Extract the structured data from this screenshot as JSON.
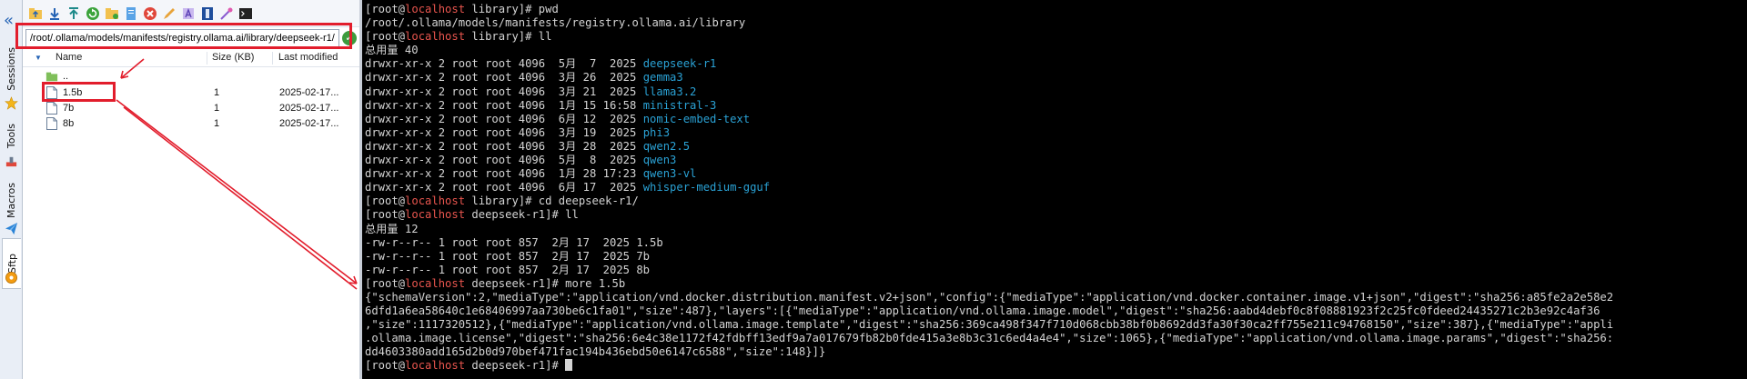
{
  "sidebar": {
    "tabs": [
      {
        "label": "Sessions",
        "icon": "star-icon"
      },
      {
        "label": "Tools",
        "icon": "tools-icon"
      },
      {
        "label": "Macros",
        "icon": "paper-plane-icon"
      },
      {
        "label": "Sftp",
        "icon": "sftp-icon"
      }
    ]
  },
  "toolbar": {
    "icons": [
      "folder-up-icon",
      "download-icon",
      "upload-icon",
      "refresh-icon",
      "new-folder-icon",
      "new-file-icon",
      "delete-icon",
      "edit-icon",
      "text-icon",
      "column-icon",
      "magic-icon",
      "terminal-icon"
    ]
  },
  "sftp": {
    "path": "/root/.ollama/models/manifests/registry.ollama.ai/library/deepseek-r1/",
    "columns": {
      "name": "Name",
      "size": "Size (KB)",
      "modified": "Last modified"
    },
    "files": [
      {
        "name": "..",
        "size": "",
        "modified": "",
        "type": "parent"
      },
      {
        "name": "1.5b",
        "size": "1",
        "modified": "2025-02-17...",
        "type": "file"
      },
      {
        "name": "7b",
        "size": "1",
        "modified": "2025-02-17...",
        "type": "file"
      },
      {
        "name": "8b",
        "size": "1",
        "modified": "2025-02-17...",
        "type": "file"
      }
    ]
  },
  "colors": {
    "accent": "#2563b5",
    "annotation": "#e21d2c",
    "terminal_bg": "#000000",
    "terminal_fg": "#d4d4d4",
    "prompt_host": "#e8554e",
    "dir_color": "#2aa1d4"
  },
  "terminal": {
    "prompt_open": "[root@",
    "host": "localhost",
    "lines": [
      {
        "kind": "prompt",
        "cwd": " library]# ",
        "cmd": "pwd"
      },
      {
        "kind": "out",
        "text": "/root/.ollama/models/manifests/registry.ollama.ai/library"
      },
      {
        "kind": "prompt",
        "cwd": " library]# ",
        "cmd": "ll"
      },
      {
        "kind": "out",
        "text": "总用量 40"
      },
      {
        "kind": "ls",
        "meta": "drwxr-xr-x 2 root root 4096  5月  7  2025 ",
        "name": "deepseek-r1"
      },
      {
        "kind": "ls",
        "meta": "drwxr-xr-x 2 root root 4096  3月 26  2025 ",
        "name": "gemma3"
      },
      {
        "kind": "ls",
        "meta": "drwxr-xr-x 2 root root 4096  3月 21  2025 ",
        "name": "llama3.2"
      },
      {
        "kind": "ls",
        "meta": "drwxr-xr-x 2 root root 4096  1月 15 16:58 ",
        "name": "ministral-3"
      },
      {
        "kind": "ls",
        "meta": "drwxr-xr-x 2 root root 4096  6月 12  2025 ",
        "name": "nomic-embed-text"
      },
      {
        "kind": "ls",
        "meta": "drwxr-xr-x 2 root root 4096  3月 19  2025 ",
        "name": "phi3"
      },
      {
        "kind": "ls",
        "meta": "drwxr-xr-x 2 root root 4096  3月 28  2025 ",
        "name": "qwen2.5"
      },
      {
        "kind": "ls",
        "meta": "drwxr-xr-x 2 root root 4096  5月  8  2025 ",
        "name": "qwen3"
      },
      {
        "kind": "ls",
        "meta": "drwxr-xr-x 2 root root 4096  1月 28 17:23 ",
        "name": "qwen3-vl"
      },
      {
        "kind": "ls",
        "meta": "drwxr-xr-x 2 root root 4096  6月 17  2025 ",
        "name": "whisper-medium-gguf"
      },
      {
        "kind": "prompt",
        "cwd": " library]# ",
        "cmd": "cd deepseek-r1/"
      },
      {
        "kind": "prompt",
        "cwd": " deepseek-r1]# ",
        "cmd": "ll"
      },
      {
        "kind": "out",
        "text": "总用量 12"
      },
      {
        "kind": "out",
        "text": "-rw-r--r-- 1 root root 857  2月 17  2025 1.5b"
      },
      {
        "kind": "out",
        "text": "-rw-r--r-- 1 root root 857  2月 17  2025 7b"
      },
      {
        "kind": "out",
        "text": "-rw-r--r-- 1 root root 857  2月 17  2025 8b"
      },
      {
        "kind": "prompt",
        "cwd": " deepseek-r1]# ",
        "cmd": "more 1.5b"
      },
      {
        "kind": "out",
        "text": "{\"schemaVersion\":2,\"mediaType\":\"application/vnd.docker.distribution.manifest.v2+json\",\"config\":{\"mediaType\":\"application/vnd.docker.container.image.v1+json\",\"digest\":\"sha256:a85fe2a2e58e2"
      },
      {
        "kind": "out",
        "text": "6dfd1a6ea58640c1e68406997aa730be6c1fa01\",\"size\":487},\"layers\":[{\"mediaType\":\"application/vnd.ollama.image.model\",\"digest\":\"sha256:aabd4debf0c8f08881923f2c25fc0fdeed24435271c2b3e92c4af36"
      },
      {
        "kind": "out",
        "text": ",\"size\":1117320512},{\"mediaType\":\"application/vnd.ollama.image.template\",\"digest\":\"sha256:369ca498f347f710d068cbb38bf0b8692dd3fa30f30ca2ff755e211c94768150\",\"size\":387},{\"mediaType\":\"appli"
      },
      {
        "kind": "out",
        "text": ".ollama.image.license\",\"digest\":\"sha256:6e4c38e1172f42fdbff13edf9a7a017679fb82b0fde415a3e8b3c31c6ed4a4e4\",\"size\":1065},{\"mediaType\":\"application/vnd.ollama.image.params\",\"digest\":\"sha256:"
      },
      {
        "kind": "out",
        "text": "dd4603380add165d2b0d970bef471fac194b436ebd50e6147c6588\",\"size\":148}]}"
      },
      {
        "kind": "prompt",
        "cwd": " deepseek-r1]# ",
        "cmd": "",
        "cursor": true
      }
    ]
  }
}
